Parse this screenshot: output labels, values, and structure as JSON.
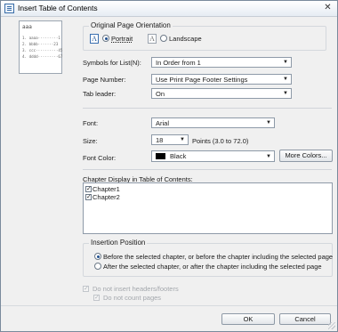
{
  "window": {
    "title": "Insert Table of Contents"
  },
  "preview": {
    "heading": "aaa",
    "lines": [
      "1. aaaa·········1",
      "2. bbbb·······23",
      "3. ccc··········45",
      "4. dddd·········67"
    ]
  },
  "orientation": {
    "legend": "Original Page Orientation",
    "portrait_label": "Portrait",
    "landscape_label": "Landscape",
    "selected": "Portrait"
  },
  "symbols": {
    "label": "Symbols for List(N):",
    "value": "In Order from 1"
  },
  "page_number": {
    "label": "Page Number:",
    "value": "Use Print Page Footer Settings"
  },
  "tab_leader": {
    "label": "Tab leader:",
    "value": "On"
  },
  "font": {
    "label": "Font:",
    "value": "Arial"
  },
  "size": {
    "label": "Size:",
    "value": "18",
    "range_text": "Points (3.0 to 72.0)"
  },
  "font_color": {
    "label": "Font Color:",
    "value": "Black",
    "swatch": "#000000",
    "more_label": "More Colors..."
  },
  "chapters": {
    "label": "Chapter Display in Table of Contents:",
    "items": [
      {
        "label": "Chapter1",
        "checked": true
      },
      {
        "label": "Chapter2",
        "checked": true
      }
    ]
  },
  "insertion": {
    "legend": "Insertion Position",
    "option_before": "Before the selected chapter, or before the chapter including the selected page",
    "option_after": "After the selected chapter, or after the chapter including the selected page",
    "selected": "before"
  },
  "options": {
    "no_headers_label": "Do not insert headers/footers",
    "no_count_label": "Do not count pages"
  },
  "buttons": {
    "ok": "OK",
    "cancel": "Cancel"
  },
  "colors": {
    "accent": "#1f4f8f",
    "dialog_bg": "#f0f0f0"
  }
}
